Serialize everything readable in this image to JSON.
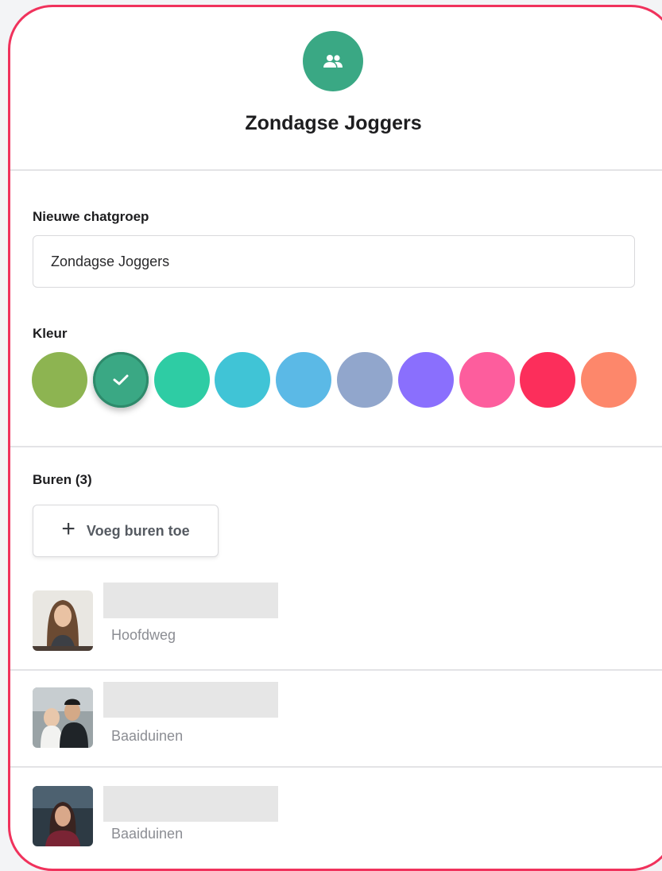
{
  "group": {
    "title": "Zondagse Joggers",
    "avatar_icon": "group-icon",
    "avatar_color": "#3aa884"
  },
  "name_field": {
    "label": "Nieuwe chatgroep",
    "value": "Zondagse Joggers"
  },
  "color_picker": {
    "label": "Kleur",
    "selected_index": 1,
    "colors": [
      "#8db451",
      "#3aa884",
      "#2ecca4",
      "#40c4d6",
      "#5bb9e6",
      "#91a6cc",
      "#8a6ffd",
      "#fd5d9d",
      "#fc2e5b",
      "#fd876b"
    ]
  },
  "neighbours": {
    "label": "Buren (3)",
    "add_button_label": "Voeg buren toe",
    "items": [
      {
        "street": "Hoofdweg"
      },
      {
        "street": "Baaiduinen"
      },
      {
        "street": "Baaiduinen"
      }
    ]
  }
}
